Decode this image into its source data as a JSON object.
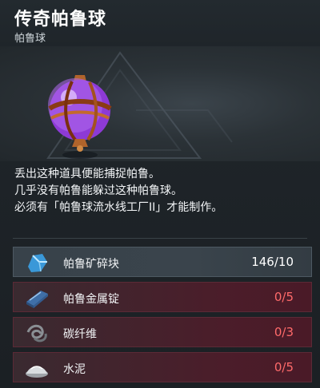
{
  "item": {
    "title": "传奇帕鲁球",
    "category": "帕鲁球",
    "icon": "legendary-sphere-icon"
  },
  "description": {
    "lines": [
      "丢出这种道具便能捕捉帕鲁。",
      "几乎没有帕鲁能躲过这种帕鲁球。",
      "必须有「帕鲁球流水线工厂II」才能制作。"
    ]
  },
  "materials": [
    {
      "name": "帕鲁矿碎块",
      "quantity": "146/10",
      "icon": "pal-fluid-crystal-icon",
      "sufficient": true
    },
    {
      "name": "帕鲁金属锭",
      "quantity": "0/5",
      "icon": "pal-metal-ingot-icon",
      "sufficient": false
    },
    {
      "name": "碳纤维",
      "quantity": "0/3",
      "icon": "carbon-fiber-icon",
      "sufficient": false
    },
    {
      "name": "水泥",
      "quantity": "0/5",
      "icon": "cement-icon",
      "sufficient": false
    }
  ],
  "colors": {
    "sufficient": "#ffffff",
    "lacking": "#ff6a6a",
    "sphere": "#9b3fe0"
  }
}
